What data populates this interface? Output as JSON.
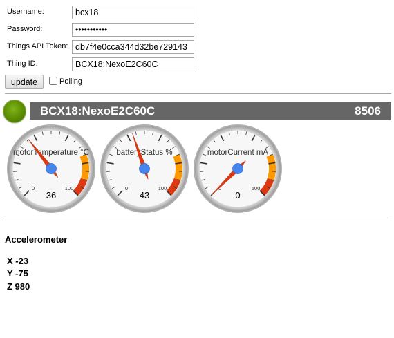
{
  "form": {
    "username_label": "Username:",
    "username_value": "bcx18",
    "password_label": "Password:",
    "password_value": "xxxxxxxxxxx",
    "token_label": "Things API Token:",
    "token_value": "db7f4e0cca344d32be729143",
    "thing_label": "Thing ID:",
    "thing_value": "BCX18:NexoE2C60C",
    "update_label": "update",
    "polling_label": "Polling",
    "polling_checked": false
  },
  "thing": {
    "status": "online",
    "status_color": "#5b8c00",
    "id": "BCX18:NexoE2C60C",
    "count": "8506"
  },
  "gauges": [
    {
      "label": "motorTemperature °C",
      "min_label": "0",
      "max_label": "100",
      "min": 0,
      "max": 100,
      "value": 36,
      "value_text": "36"
    },
    {
      "label": "batteryStatus %",
      "min_label": "0",
      "max_label": "100",
      "min": 0,
      "max": 100,
      "value": 43,
      "value_text": "43"
    },
    {
      "label": "motorCurrent mA",
      "min_label": "0",
      "max_label": "500",
      "min": 0,
      "max": 500,
      "value": 0,
      "value_text": "0"
    }
  ],
  "gauge_colors": {
    "needle": "#dc3912",
    "hub": "#4684ee",
    "yellow": "#ff9900",
    "red": "#dc3912"
  },
  "accelerometer": {
    "title": "Accelerometer",
    "x": "X -23",
    "y": "Y -75",
    "z": "Z 980"
  }
}
